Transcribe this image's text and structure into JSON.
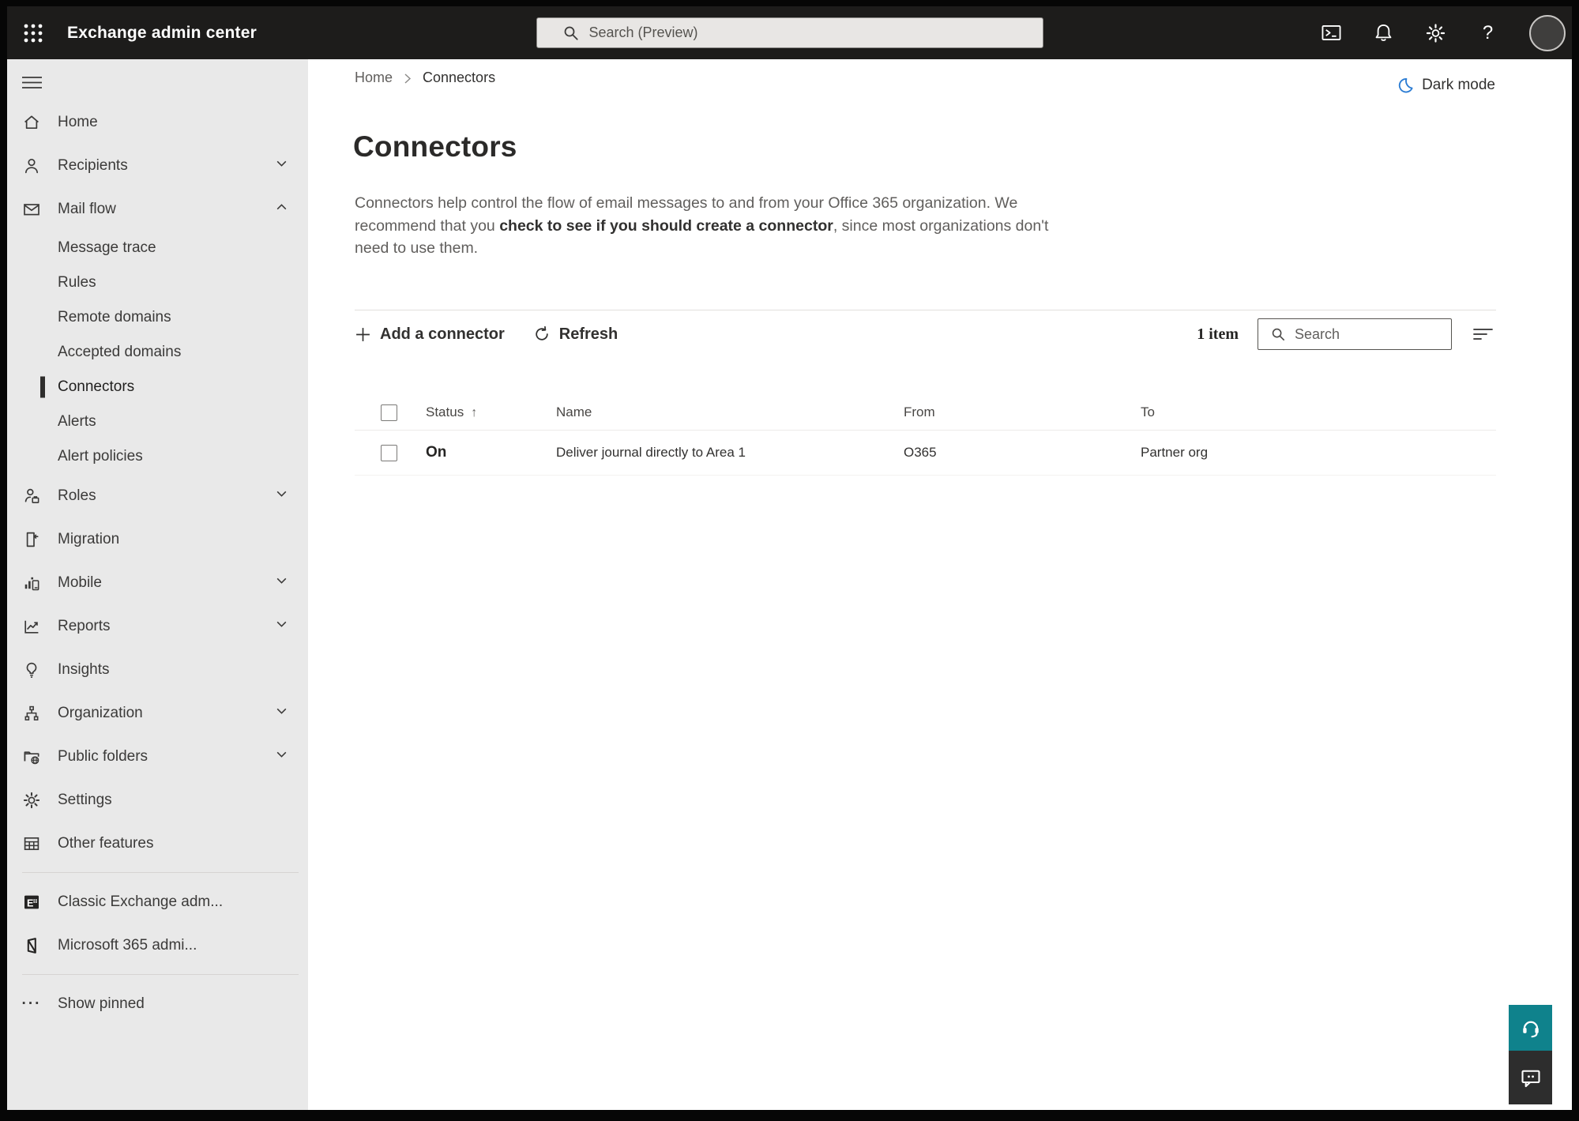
{
  "app": {
    "title": "Exchange admin center"
  },
  "topbar": {
    "search_placeholder": "Search (Preview)"
  },
  "sidebar": {
    "items": [
      {
        "label": "Home"
      },
      {
        "label": "Recipients"
      },
      {
        "label": "Mail flow"
      },
      {
        "label": "Message trace"
      },
      {
        "label": "Rules"
      },
      {
        "label": "Remote domains"
      },
      {
        "label": "Accepted domains"
      },
      {
        "label": "Connectors"
      },
      {
        "label": "Alerts"
      },
      {
        "label": "Alert policies"
      },
      {
        "label": "Roles"
      },
      {
        "label": "Migration"
      },
      {
        "label": "Mobile"
      },
      {
        "label": "Reports"
      },
      {
        "label": "Insights"
      },
      {
        "label": "Organization"
      },
      {
        "label": "Public folders"
      },
      {
        "label": "Settings"
      },
      {
        "label": "Other features"
      },
      {
        "label": "Classic Exchange adm..."
      },
      {
        "label": "Microsoft 365 admi..."
      },
      {
        "label": "Show pinned"
      }
    ]
  },
  "breadcrumb": {
    "home": "Home",
    "current": "Connectors"
  },
  "dark_mode_label": "Dark mode",
  "page": {
    "title": "Connectors",
    "description_before": "Connectors help control the flow of email messages to and from your Office 365 organization. We recommend that you ",
    "description_emphasis": "check to see if you should create a connector",
    "description_after": ", since most organizations don't need to use them."
  },
  "toolbar": {
    "add_label": "Add a connector",
    "refresh_label": "Refresh",
    "item_count": "1 item",
    "search_placeholder": "Search"
  },
  "table": {
    "headers": [
      "Status",
      "Name",
      "From",
      "To"
    ],
    "sort_arrow": "↑",
    "rows": [
      {
        "status": "On",
        "name": "Deliver journal directly to Area 1",
        "from": "O365",
        "to": "Partner org"
      }
    ]
  },
  "colors": {
    "topbar_bg": "#1d1c1b",
    "sidebar_bg": "#e9e9e9",
    "selected_indicator": "#2e2d2c",
    "moon_blue": "#2b7cd3",
    "support_teal": "#0f828c",
    "feedback_dark": "#2d2d2d"
  }
}
